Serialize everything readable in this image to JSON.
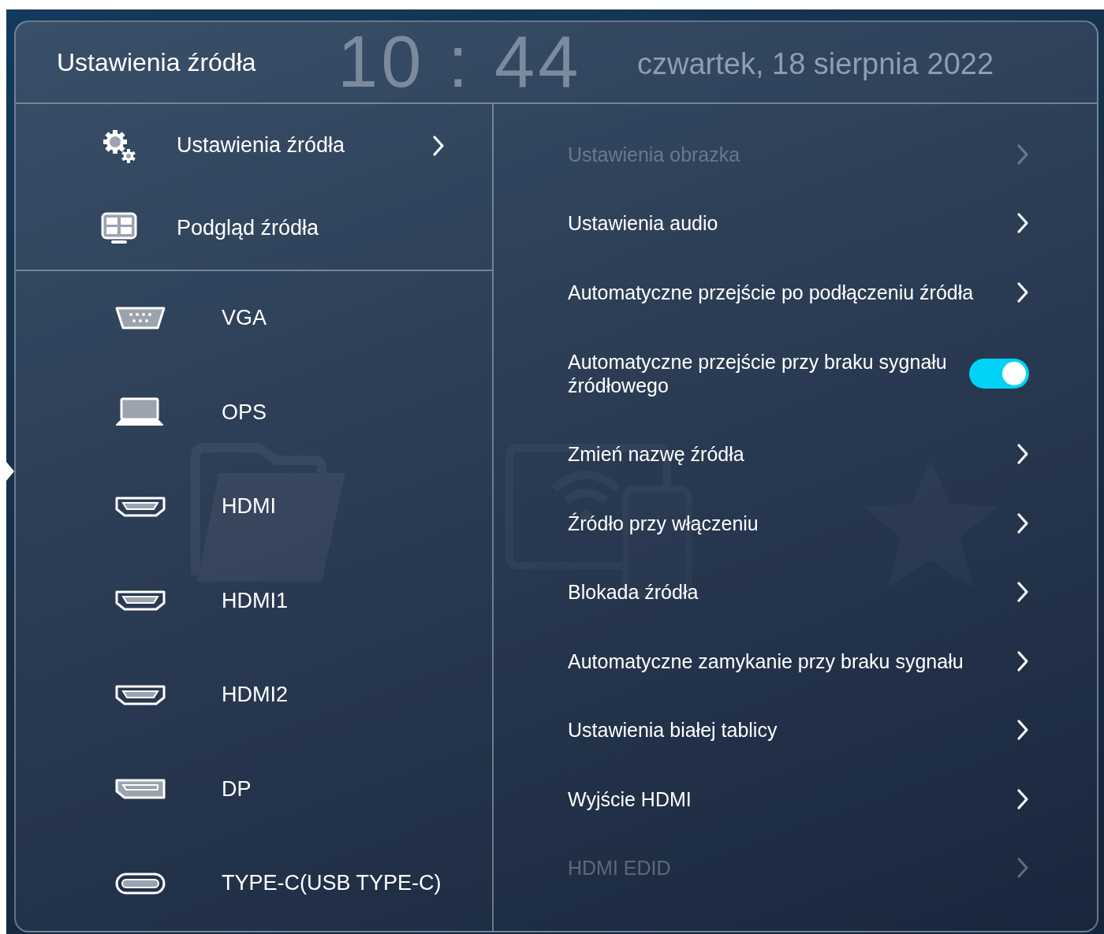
{
  "background": {
    "clock": "10 : 44",
    "date": "czwartek, 18 sierpnia 2022"
  },
  "header": {
    "title": "Ustawienia źródła"
  },
  "menu": [
    {
      "label": "Ustawienia źródła",
      "has_arrow": true
    },
    {
      "label": "Podgląd źródła",
      "has_arrow": false
    }
  ],
  "sources": [
    {
      "label": "VGA"
    },
    {
      "label": "OPS"
    },
    {
      "label": "HDMI"
    },
    {
      "label": "HDMI1"
    },
    {
      "label": "HDMI2"
    },
    {
      "label": "DP"
    },
    {
      "label": "TYPE-C(USB TYPE-C)"
    }
  ],
  "settings": [
    {
      "kind": "link",
      "label": "Ustawienia obrazka",
      "disabled": true
    },
    {
      "kind": "link",
      "label": "Ustawienia audio",
      "disabled": false
    },
    {
      "kind": "link",
      "label": "Automatyczne przejście po podłączeniu źródła",
      "disabled": false
    },
    {
      "kind": "toggle",
      "label": "Automatyczne przejście przy braku sygnału źródłowego",
      "on": true,
      "disabled": false
    },
    {
      "kind": "link",
      "label": "Zmień nazwę źródła",
      "disabled": false
    },
    {
      "kind": "link",
      "label": "Źródło przy włączeniu",
      "disabled": false
    },
    {
      "kind": "link",
      "label": "Blokada źródła",
      "disabled": false
    },
    {
      "kind": "link",
      "label": "Automatyczne zamykanie przy braku sygnału",
      "disabled": false
    },
    {
      "kind": "link",
      "label": "Ustawienia białej tablicy",
      "disabled": false
    },
    {
      "kind": "link",
      "label": "Wyjście HDMI",
      "disabled": false
    },
    {
      "kind": "link",
      "label": "HDMI EDID",
      "disabled": true
    }
  ]
}
